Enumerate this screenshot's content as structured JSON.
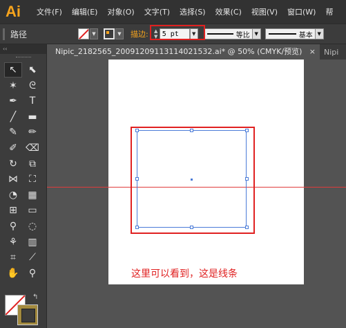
{
  "app": {
    "logo": "Ai"
  },
  "menu": [
    "文件(F)",
    "编辑(E)",
    "对象(O)",
    "文字(T)",
    "选择(S)",
    "效果(C)",
    "视图(V)",
    "窗口(W)",
    "帮"
  ],
  "control": {
    "selection_type": "路径",
    "stroke_label": "描边:",
    "stroke_value": "5 pt",
    "profile_label": "等比",
    "brush_label": "基本"
  },
  "document": {
    "tab_title": "Nipic_2182565_20091209113114021532.ai* @ 50% (CMYK/预览)",
    "tab_close": "×",
    "tab2_title": "Nipi"
  },
  "toolbar": {
    "header": "‹‹",
    "swap_icon": "↰"
  },
  "caption": "这里可以看到，这是线条",
  "colors": {
    "accent": "#f7a41d",
    "annotation": "#e02020",
    "selection": "#4a7bd8",
    "guide": "#e03c3c"
  },
  "tools": [
    {
      "name": "selection-tool-icon",
      "glyph": "↖"
    },
    {
      "name": "direct-selection-tool-icon",
      "glyph": "⬉"
    },
    {
      "name": "magic-wand-tool-icon",
      "glyph": "✶"
    },
    {
      "name": "lasso-tool-icon",
      "glyph": "ᘓ"
    },
    {
      "name": "pen-tool-icon",
      "glyph": "✒"
    },
    {
      "name": "type-tool-icon",
      "glyph": "T"
    },
    {
      "name": "line-tool-icon",
      "glyph": "╱"
    },
    {
      "name": "rectangle-tool-icon",
      "glyph": "▬"
    },
    {
      "name": "paintbrush-tool-icon",
      "glyph": "✎"
    },
    {
      "name": "pencil-tool-icon",
      "glyph": "✏"
    },
    {
      "name": "blob-brush-tool-icon",
      "glyph": "✐"
    },
    {
      "name": "eraser-tool-icon",
      "glyph": "⌫"
    },
    {
      "name": "rotate-tool-icon",
      "glyph": "↻"
    },
    {
      "name": "scale-tool-icon",
      "glyph": "⧉"
    },
    {
      "name": "width-tool-icon",
      "glyph": "⋈"
    },
    {
      "name": "free-transform-tool-icon",
      "glyph": "⛶"
    },
    {
      "name": "shape-builder-tool-icon",
      "glyph": "◔"
    },
    {
      "name": "graph-tool-icon",
      "glyph": "▦"
    },
    {
      "name": "mesh-tool-icon",
      "glyph": "⊞"
    },
    {
      "name": "gradient-tool-icon",
      "glyph": "▭"
    },
    {
      "name": "eyedropper-tool-icon",
      "glyph": "⚲"
    },
    {
      "name": "blend-tool-icon",
      "glyph": "◌"
    },
    {
      "name": "symbol-sprayer-tool-icon",
      "glyph": "⚘"
    },
    {
      "name": "column-graph-tool-icon",
      "glyph": "▥"
    },
    {
      "name": "artboard-tool-icon",
      "glyph": "⌗"
    },
    {
      "name": "slice-tool-icon",
      "glyph": "⟋"
    },
    {
      "name": "hand-tool-icon",
      "glyph": "✋"
    },
    {
      "name": "zoom-tool-icon",
      "glyph": "⚲"
    }
  ]
}
